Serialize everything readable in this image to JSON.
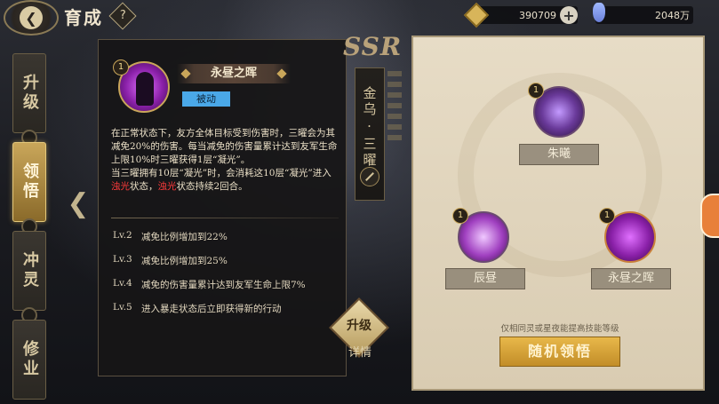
{
  "header": {
    "title": "育成",
    "help_glyph": "?",
    "back_icon": "chevron-left-icon",
    "gold_value": "390709",
    "gem_value": "2048万",
    "plus_glyph": "+"
  },
  "tabs": [
    {
      "label": "升级",
      "active": false
    },
    {
      "label": "领悟",
      "active": true
    },
    {
      "label": "冲灵",
      "active": false
    },
    {
      "label": "修业",
      "active": false
    }
  ],
  "tooltip": {
    "level_badge": "1",
    "name": "永昼之晖",
    "tag": "被动",
    "desc_parts": [
      "在正常状态下，友方全体目标受到伤害时，三曜会为其减免20%的伤害。每当减免的伤害量累计达到友军生命上限10%时三曜获得1层“凝光”。",
      "当三曜拥有10层“凝光”时，会消耗这10层“凝光”进入",
      "浊光",
      "状态，",
      "浊光",
      "状态持续2回合。"
    ],
    "levels": [
      {
        "lv": "Lv.2",
        "text": "减免比例增加到22%"
      },
      {
        "lv": "Lv.3",
        "text": "减免比例增加到25%"
      },
      {
        "lv": "Lv.4",
        "text": "减免的伤害量累计达到友军生命上限7%"
      },
      {
        "lv": "Lv.5",
        "text": "进入暴走状态后立即获得新的行动"
      }
    ]
  },
  "middle": {
    "rarity": "SSR",
    "character_name": "金乌·三曜",
    "upgrade_label": "升级",
    "detail_label": "详情"
  },
  "skills_panel": {
    "nodes": [
      {
        "name": "朱曦",
        "level": "1"
      },
      {
        "name": "辰昼",
        "level": "1"
      },
      {
        "name": "永昼之晖",
        "level": "1"
      }
    ],
    "hint": "仅相同灵或星夜能提高技能等级",
    "random_button": "随机领悟"
  },
  "colors": {
    "accent_gold": "#c9a65a",
    "highlight_red": "#ff3b3b",
    "passive_tag": "#4aa8e8",
    "button_orange": "#e8b84a"
  }
}
